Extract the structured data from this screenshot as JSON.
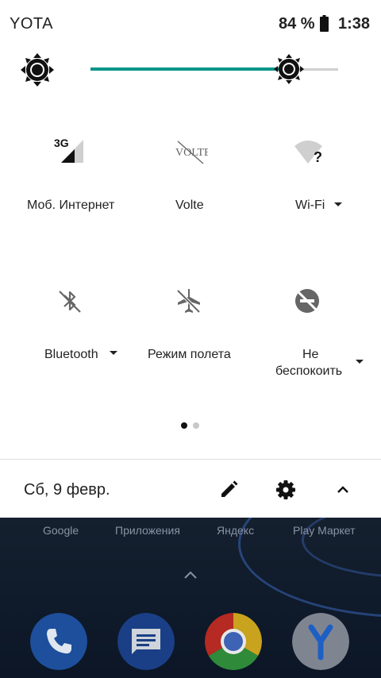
{
  "status_bar": {
    "carrier": "YOTA",
    "battery_percent": "84 %",
    "time": "1:38"
  },
  "brightness": {
    "level": 0.8,
    "track_color": "#009688"
  },
  "tiles": [
    {
      "label": "Моб. Интернет",
      "icon": "mobile-data-3g-icon"
    },
    {
      "label": "Volte",
      "icon": "volte-off-icon",
      "icon_text": "VOLTE"
    },
    {
      "label": "Wi-Fi",
      "icon": "wifi-unknown-icon",
      "has_dropdown": true
    },
    {
      "label": "Bluetooth",
      "icon": "bluetooth-off-icon",
      "has_dropdown": true
    },
    {
      "label": "Режим полета",
      "icon": "airplane-mode-off-icon"
    },
    {
      "label_line1": "Не",
      "label_line2": "беспокоить",
      "icon": "do-not-disturb-off-icon",
      "has_dropdown": true
    }
  ],
  "page_indicator": {
    "current": 1,
    "total": 2
  },
  "footer": {
    "date": "Сб, 9 февр.",
    "edit": "edit-icon",
    "settings": "gear-icon",
    "collapse": "chevron-up-icon"
  },
  "home_screen": {
    "labels": [
      "Google",
      "Приложения",
      "Яндекс",
      "Play Маркет"
    ],
    "dock": [
      "phone",
      "messages",
      "chrome",
      "yandex-browser"
    ]
  }
}
